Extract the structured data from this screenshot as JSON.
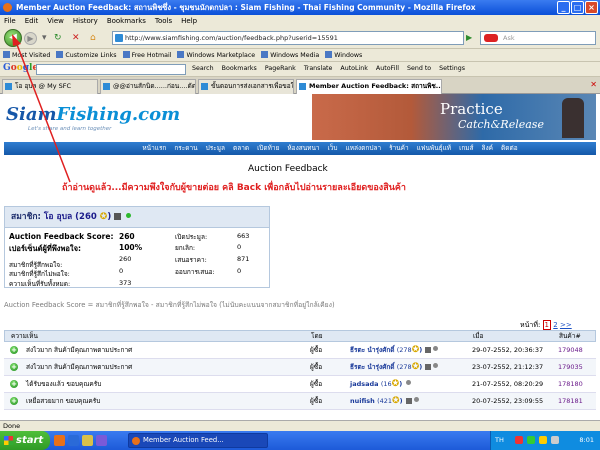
{
  "window": {
    "title": "Member Auction Feedback: สถานพิชซึ่ง - ชุมชนนักตกปลา : Siam Fishing - Thai Fishing Community - Mozilla Firefox"
  },
  "menu": [
    "File",
    "Edit",
    "View",
    "History",
    "Bookmarks",
    "Tools",
    "Help"
  ],
  "nav": {
    "url": "http://www.siamfishing.com/auction/feedback.php?userid=15591",
    "search_placeholder": "Ask"
  },
  "bookmarks": [
    "Most Visited",
    "Customize Links",
    "Free Hotmail",
    "Windows Marketplace",
    "Windows Media",
    "Windows"
  ],
  "google_toolbar": {
    "search": "Search",
    "items": [
      "Bookmarks",
      "PageRank",
      "Translate",
      "AutoLink",
      "AutoFill",
      "Send to",
      "Settings"
    ]
  },
  "tabs": [
    {
      "label": "โอ อุบล @ My SFC"
    },
    {
      "label": "@@อ่านสักนิด......ก่อน....ตัดประมูล @@..."
    },
    {
      "label": "ขั้นตอนการส่งเอกสารเพื่อขอใบตอบบัตร"
    },
    {
      "label": "Member Auction Feedback: สถานพิช...",
      "active": true
    }
  ],
  "site": {
    "logo_siam": "Siam",
    "logo_fishing": "Fishing.com",
    "slogan": "Let's share and learn together",
    "banner_line1": "Practice",
    "banner_line2": "Catch&Release",
    "nav_items": [
      "หน้าแรก",
      "กระดาน",
      "ประมูล",
      "ตลาด",
      "เปิดท้าย",
      "ห้องสนทนา",
      "เว็บ",
      "แหล่งตกปลา",
      "ร้านค้า",
      "แฟนพันธุ์แท้",
      "เกมส์",
      "ลิงค์",
      "ติดต่อ"
    ]
  },
  "page": {
    "title": "Auction Feedback",
    "annotation": "ถ้าอ่านดูแล้ว...มีความพึงใจกับผู้ขายต่อย คลิ Back เพื่อกลับไปอ่านรายละเอียดของสินค้า"
  },
  "member": {
    "label": "สมาชิก:",
    "name": "โอ อุบล",
    "score": "(260",
    "score_close": ")"
  },
  "stats": {
    "feedback_score_label": "Auction Feedback Score:",
    "feedback_score": "260",
    "positive_pct_label": "เปอร์เซ็นต์ผู้ที่พึงพอใจ:",
    "positive_pct": "100%",
    "satisfied_label": "สมาชิกที่รู้สึกพอใจ:",
    "satisfied": "260",
    "unsatisfied_label": "สมาชิกที่รู้สึกไม่พอใจ:",
    "unsatisfied": "0",
    "total_label": "ความเห็นที่รับทั้งหมด:",
    "total": "373",
    "open_label": "เปิดประมูล:",
    "open": "663",
    "cancel_label": "ยกเลิก:",
    "cancel": "0",
    "bid_label": "เสนอราคา:",
    "bid": "871",
    "bid_win_label": "ออบการเสนอ:",
    "bid_win": "0"
  },
  "breadcrumb": "Auction Feedback Score = สมาชิกที่รู้สึกพอใจ - สมาชิกที่รู้สึกไม่พอใจ (ไม่นับคะแนนจากสมาชิกที่อยู่ใกล้เคียง)",
  "pagination": {
    "label": "หน้าที่:",
    "pages": [
      "1",
      "2"
    ],
    "next": ">>"
  },
  "table": {
    "headers": {
      "comment": "ความเห็น",
      "by": "โดย",
      "when": "เมื่อ",
      "item": "สินค้า#"
    },
    "rows": [
      {
        "comment": "ส่งไวมาก สินค้ามีคุณภาพตามประกาศ",
        "by": "ผู้ซื้อ",
        "user": "ธีรตะ นำรุ่งศักดิ์",
        "score": "(278",
        "when": "29-07-2552, 20:36:37",
        "item": "179048"
      },
      {
        "comment": "ส่งไวมาก สินค้ามีคุณภาพตามประกาศ",
        "by": "ผู้ซื้อ",
        "user": "ธีรตะ นำรุ่งศักดิ์",
        "score": "(278",
        "when": "23-07-2552, 21:12:37",
        "item": "179035"
      },
      {
        "comment": "ได้รับของแล้ว ขอบคุณครับ",
        "by": "ผู้ซื้อ",
        "user": "jadsada",
        "score": "(16",
        "when": "21-07-2552, 08:20:29",
        "item": "178180"
      },
      {
        "comment": "เหยื่อสวยมาก ขอบคุณครับ",
        "by": "ผู้ซื้อ",
        "user": "nuifish",
        "score": "(421",
        "when": "20-07-2552, 23:09:55",
        "item": "178181"
      }
    ]
  },
  "status": "Done",
  "taskbar": {
    "start": "start",
    "task": "Member Auction Feed...",
    "lang": "TH",
    "clock": "8:01"
  }
}
